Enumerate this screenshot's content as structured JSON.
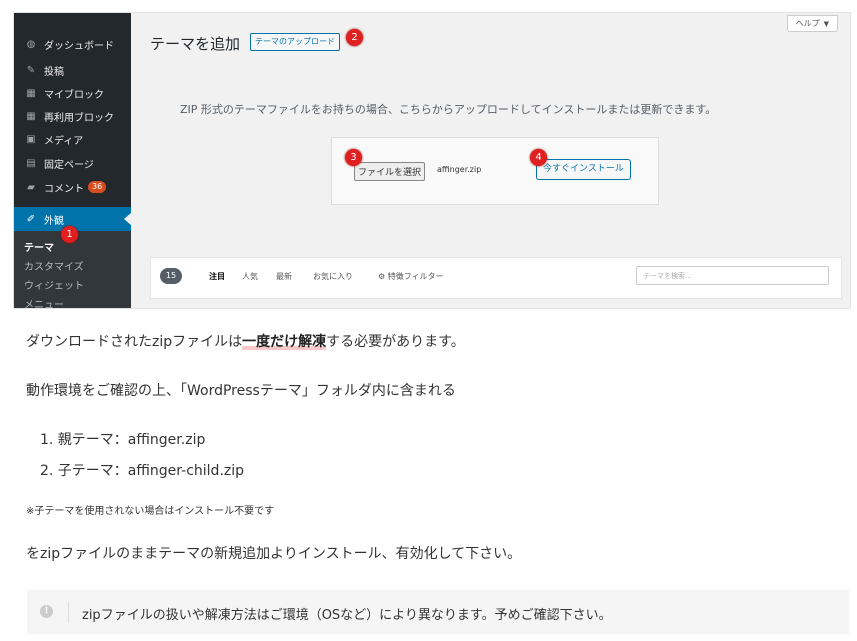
{
  "sidebar": {
    "items": [
      {
        "label": "ダッシュボード",
        "icon": "dashboard-icon",
        "glyph": "◍"
      },
      {
        "label": "投稿",
        "icon": "pin-icon",
        "glyph": "✎"
      },
      {
        "label": "マイブロック",
        "icon": "blocks-icon",
        "glyph": "▦"
      },
      {
        "label": "再利用ブロック",
        "icon": "blocks-icon",
        "glyph": "▦"
      },
      {
        "label": "メディア",
        "icon": "media-icon",
        "glyph": "▣"
      },
      {
        "label": "固定ページ",
        "icon": "page-icon",
        "glyph": "▤"
      },
      {
        "label": "コメント",
        "icon": "comment-icon",
        "glyph": "▰",
        "badge": "36"
      },
      {
        "label": "外観",
        "icon": "appearance-icon",
        "glyph": "✐"
      }
    ],
    "submenu": [
      "テーマ",
      "カスタマイズ",
      "ウィジェット",
      "メニュー"
    ]
  },
  "header": {
    "title": "テーマを追加",
    "upload_button": "テーマのアップロード",
    "help": "ヘルプ",
    "help_caret": "▼"
  },
  "upload": {
    "instruction": "ZIP 形式のテーマファイルをお持ちの場合、こちらからアップロードしてインストールまたは更新できます。",
    "choose_button": "ファイルを選択",
    "filename": "affinger.zip",
    "install_button": "今すぐインストール"
  },
  "filter": {
    "count": "15",
    "tabs": [
      "注目",
      "人気",
      "最新",
      "お気に入り"
    ],
    "feature_filter": "特徴フィルター",
    "search_placeholder": "テーマを検索..."
  },
  "markers": [
    "1",
    "2",
    "3",
    "4"
  ],
  "article": {
    "p1_before": "ダウンロードされたzipファイルは",
    "p1_bold": "一度だけ解凍",
    "p1_after": "する必要があります。",
    "p2": "動作環境をご確認の上、「WordPressテーマ」フォルダ内に含まれる",
    "list": [
      "1. 親テーマ：affinger.zip",
      "2. 子テーマ：affinger-child.zip"
    ],
    "note": "※子テーマを使用されない場合はインストール不要です",
    "p3": "をzipファイルのままテーマの新規追加よりインストール、有効化して下さい。",
    "notice_icon": "!",
    "notice": "zipファイルの扱いや解凍方法はご環境（OSなど）により異なります。予めご確認下さい。"
  },
  "colors": {
    "accent": "#0073aa",
    "marker": "#e02020",
    "sidebar": "#23282d"
  }
}
